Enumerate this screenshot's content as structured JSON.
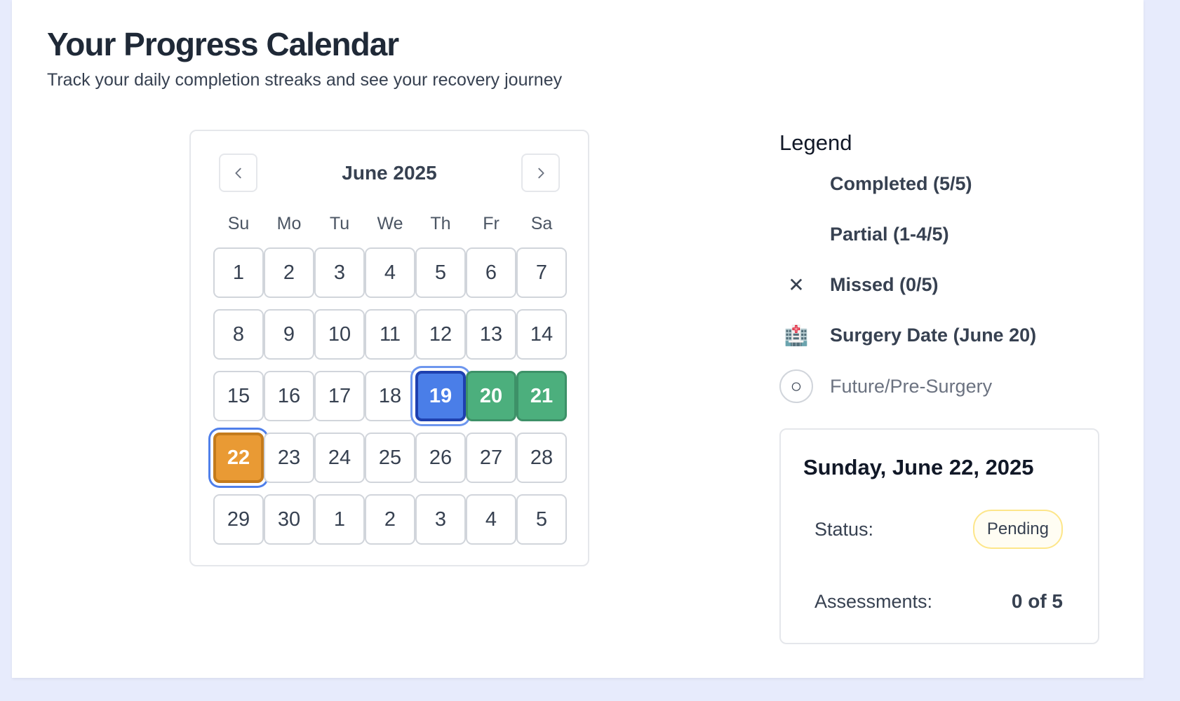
{
  "page": {
    "title": "Your Progress Calendar",
    "subtitle": "Track your daily completion streaks and see your recovery journey"
  },
  "calendar": {
    "month_label": "June 2025",
    "weekdays": [
      "Su",
      "Mo",
      "Tu",
      "We",
      "Th",
      "Fr",
      "Sa"
    ],
    "weeks": [
      [
        {
          "d": "1",
          "s": "normal"
        },
        {
          "d": "2",
          "s": "normal"
        },
        {
          "d": "3",
          "s": "normal"
        },
        {
          "d": "4",
          "s": "normal"
        },
        {
          "d": "5",
          "s": "normal"
        },
        {
          "d": "6",
          "s": "normal"
        },
        {
          "d": "7",
          "s": "normal"
        }
      ],
      [
        {
          "d": "8",
          "s": "normal"
        },
        {
          "d": "9",
          "s": "normal"
        },
        {
          "d": "10",
          "s": "normal"
        },
        {
          "d": "11",
          "s": "normal"
        },
        {
          "d": "12",
          "s": "normal"
        },
        {
          "d": "13",
          "s": "normal"
        },
        {
          "d": "14",
          "s": "normal"
        }
      ],
      [
        {
          "d": "15",
          "s": "normal"
        },
        {
          "d": "16",
          "s": "normal"
        },
        {
          "d": "17",
          "s": "normal"
        },
        {
          "d": "18",
          "s": "normal"
        },
        {
          "d": "19",
          "s": "today"
        },
        {
          "d": "20",
          "s": "completed"
        },
        {
          "d": "21",
          "s": "completed"
        }
      ],
      [
        {
          "d": "22",
          "s": "pending"
        },
        {
          "d": "23",
          "s": "normal"
        },
        {
          "d": "24",
          "s": "normal"
        },
        {
          "d": "25",
          "s": "normal"
        },
        {
          "d": "26",
          "s": "normal"
        },
        {
          "d": "27",
          "s": "normal"
        },
        {
          "d": "28",
          "s": "normal"
        }
      ],
      [
        {
          "d": "29",
          "s": "normal"
        },
        {
          "d": "30",
          "s": "normal"
        },
        {
          "d": "1",
          "s": "normal"
        },
        {
          "d": "2",
          "s": "normal"
        },
        {
          "d": "3",
          "s": "normal"
        },
        {
          "d": "4",
          "s": "normal"
        },
        {
          "d": "5",
          "s": "normal"
        }
      ]
    ],
    "colors": {
      "today": "#4a7ee8",
      "completed": "#4caf7d",
      "pending": "#e99a34"
    }
  },
  "legend": {
    "title": "Legend",
    "items": [
      {
        "icon": "",
        "label": "Completed (5/5)"
      },
      {
        "icon": "",
        "label": "Partial (1-4/5)"
      },
      {
        "icon": "✕",
        "label": "Missed (0/5)"
      },
      {
        "icon": "🏥",
        "label": "Surgery Date (June 20)"
      },
      {
        "icon": "○",
        "label": "Future/Pre-Surgery"
      }
    ]
  },
  "detail": {
    "date": "Sunday, June 22, 2025",
    "status_label": "Status:",
    "status_value": "Pending",
    "assessments_label": "Assessments:",
    "assessments_value": "0 of 5"
  }
}
